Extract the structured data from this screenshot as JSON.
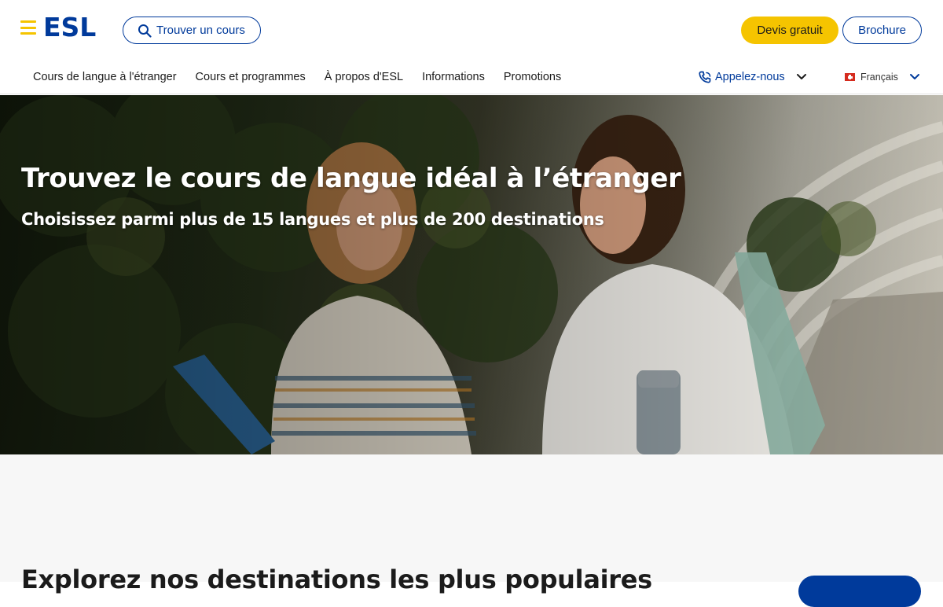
{
  "colors": {
    "brand_blue": "#003a9b",
    "brand_yellow": "#f5c400",
    "text_dark": "#1b1b1b",
    "section_bg": "#f7f7f7"
  },
  "header": {
    "logo_text": "ESL",
    "search_label": "Trouver un cours",
    "quote_label": "Devis gratuit",
    "brochure_label": "Brochure"
  },
  "nav": {
    "items": [
      {
        "label": "Cours de langue à l'étranger"
      },
      {
        "label": "Cours et programmes"
      },
      {
        "label": "À propos d'ESL"
      },
      {
        "label": "Informations"
      },
      {
        "label": "Promotions"
      }
    ],
    "call_label": "Appelez-nous",
    "language_label": "Français"
  },
  "hero": {
    "title": "Trouvez le cours de langue idéal à l’étranger",
    "subtitle": "Choisissez parmi plus de 15 langues et plus de 200 destinations"
  },
  "section": {
    "title": "Explorez nos destinations les plus populaires"
  },
  "icons": {
    "menu": "menu-icon",
    "search": "search-icon",
    "phone": "phone-icon",
    "chevron": "chevron-down-icon",
    "flag": "swiss-flag-icon"
  }
}
